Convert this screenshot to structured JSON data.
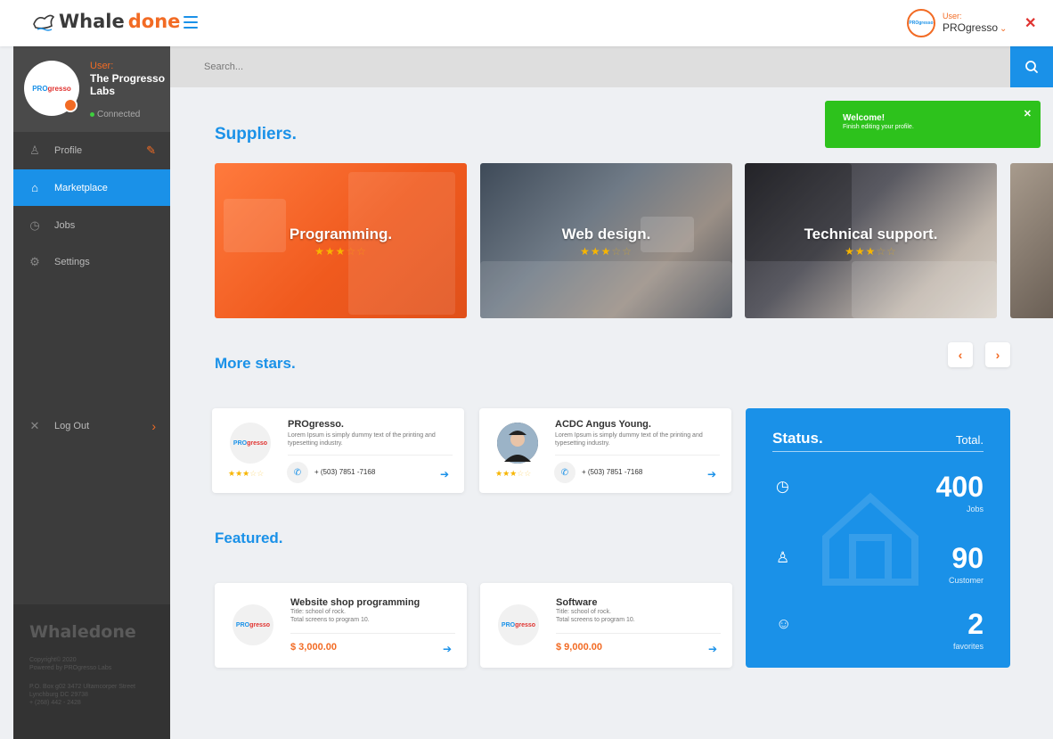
{
  "header": {
    "logo_text_a": "Whale",
    "logo_text_b": "done",
    "user_label": "User:",
    "user_name": "PROgresso",
    "avatar_text": "PROgresso"
  },
  "sidebar": {
    "user_label": "User:",
    "user_name": "The Progresso Labs",
    "status": "Connected",
    "avatar_part1": "PRO",
    "avatar_part2": "gresso",
    "items": [
      {
        "label": "Profile"
      },
      {
        "label": "Marketplace"
      },
      {
        "label": "Jobs"
      },
      {
        "label": "Settings"
      },
      {
        "label": "Log Out"
      }
    ],
    "footer_logo": "Whaledone",
    "copyright": "Copyright© 2020",
    "powered": "Powered by PROgresso Labs",
    "address1": "P.O. Box g02 3472 Ultamcorper Street",
    "address2": "Lynchburg DC 29738",
    "phone": "+ (268) 442 - 2428"
  },
  "search": {
    "placeholder": "Search..."
  },
  "toast": {
    "title": "Welcome!",
    "message": "Finish editing your profile."
  },
  "sections": {
    "suppliers": "Suppliers.",
    "more_stars": "More stars.",
    "featured": "Featured."
  },
  "suppliers": [
    {
      "label": "Programming.",
      "rating": 3
    },
    {
      "label": "Web design.",
      "rating": 3
    },
    {
      "label": "Technical support.",
      "rating": 3
    }
  ],
  "more_stars": [
    {
      "name": "PROgresso.",
      "desc": "Lorem Ipsum is simply dummy text of the printing and typesetting industry.",
      "phone": "+ (503) 7851 -7168",
      "rating": 3,
      "avatar_part1": "PRO",
      "avatar_part2": "gresso"
    },
    {
      "name": "ACDC Angus Young.",
      "desc": "Lorem Ipsum is simply dummy text of the printing and typesetting industry.",
      "phone": "+ (503) 7851 -7168",
      "rating": 3
    }
  ],
  "featured": [
    {
      "name": "Website shop programming",
      "title": "Title: school of rock.",
      "screens": "Total screens to program 10.",
      "price": "$ 3,000.00",
      "avatar_part1": "PRO",
      "avatar_part2": "gresso"
    },
    {
      "name": "Software",
      "title": "Title: school of rock.",
      "screens": "Total screens to program 10.",
      "price": "$ 9,000.00",
      "avatar_part1": "PRO",
      "avatar_part2": "gresso"
    }
  ],
  "status": {
    "title": "Status.",
    "total_label": "Total.",
    "rows": [
      {
        "value": "400",
        "label": "Jobs",
        "icon": "clock-icon"
      },
      {
        "value": "90",
        "label": "Customer",
        "icon": "person-icon"
      },
      {
        "value": "2",
        "label": "favorites",
        "icon": "smile-icon"
      }
    ]
  },
  "colors": {
    "accent": "#1a91e8",
    "orange": "#f26b24",
    "success": "#2dc21c",
    "sidebar": "#3c3c3c"
  }
}
